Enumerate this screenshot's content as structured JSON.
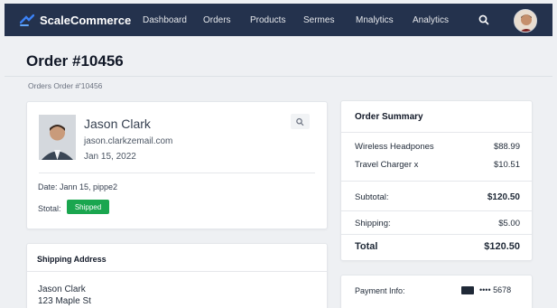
{
  "nav": {
    "brand": "ScaleCommerce",
    "items": [
      "Dashboard",
      "Orders",
      "Products",
      "Sermes",
      "Mnalytics",
      "Analytics"
    ],
    "accent": "#24324d"
  },
  "page": {
    "title": "Order #10456",
    "breadcrumb": "Orders Order #'10456"
  },
  "customer": {
    "name": "Jason Clark",
    "email": "jason.clarkzemail.com",
    "date": "Jan 15, 2022",
    "detail_date": "Date:  Jann 15, pippe2",
    "status_label": "Stotal:",
    "status_badge": "Shipped",
    "status_color": "#1aa64f"
  },
  "shipping": {
    "title": "Shipping Address",
    "name": "Jason Clark",
    "street": "123 Maple St"
  },
  "summary": {
    "title": "Order Summary",
    "items": [
      {
        "name": "Wireless Headpones",
        "price": "$88.99"
      },
      {
        "name": "Travel Charger x",
        "price": "$10.51"
      }
    ],
    "subtotal_label": "Subtotal:",
    "subtotal_value": "$120.50",
    "shipping_label": "Shipping:",
    "shipping_value": "$5.00",
    "total_label": "Total",
    "total_value": "$120.50"
  },
  "payment": {
    "label": "Payment Info:",
    "card_number": "•••• 5678"
  }
}
